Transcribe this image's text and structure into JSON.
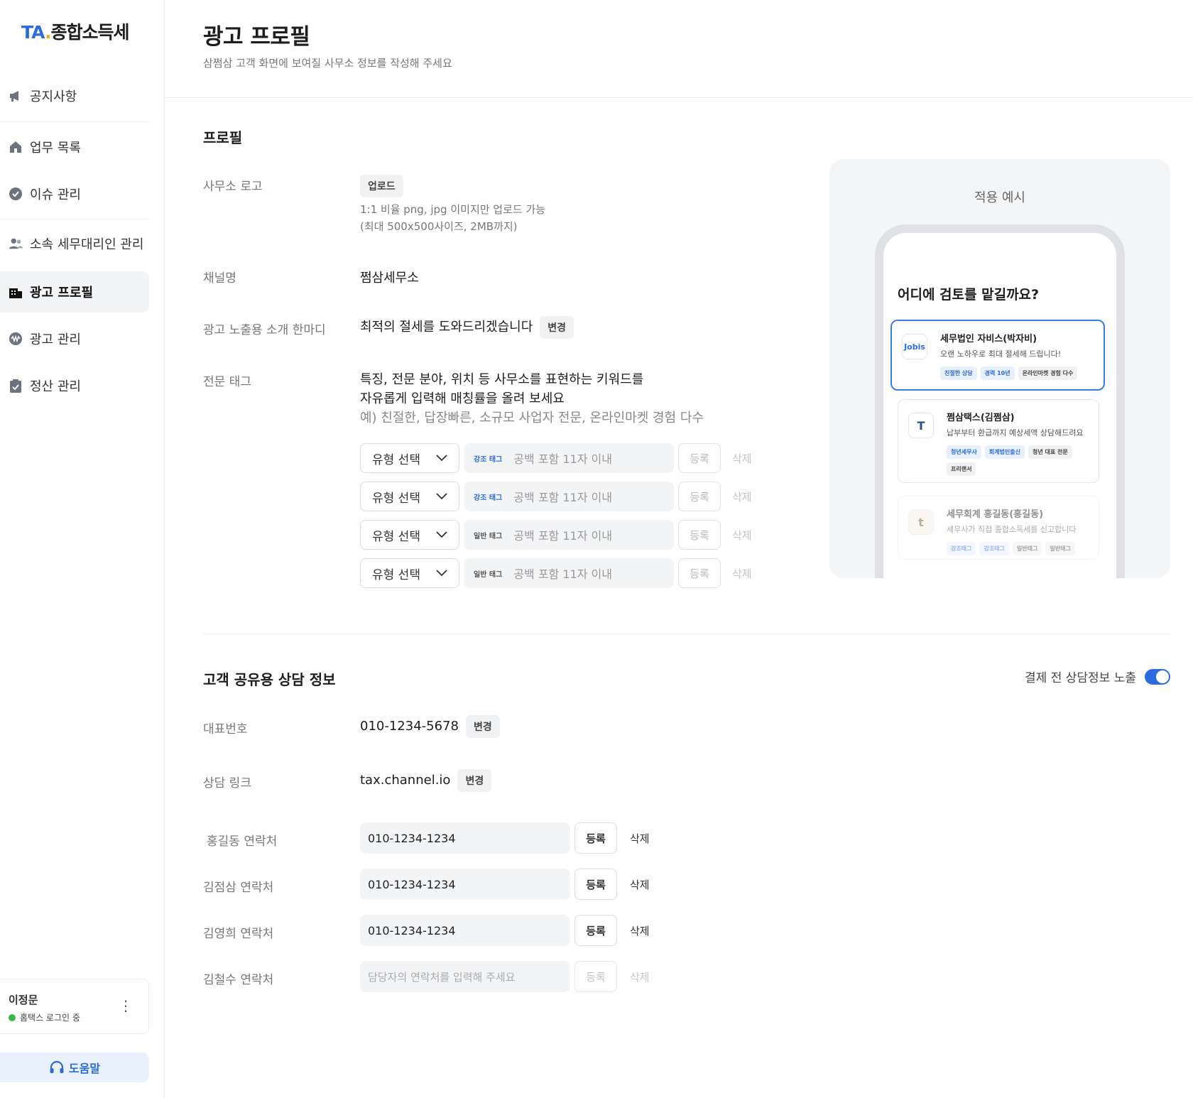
{
  "app": {
    "logo_ta": "TA",
    "logo_dot": ".",
    "logo_name": "종합소득세"
  },
  "sidebar": {
    "items": [
      {
        "label": "공지사항",
        "icon": "megaphone-icon"
      },
      {
        "label": "업무 목록",
        "icon": "home-icon"
      },
      {
        "label": "이슈 관리",
        "icon": "check-circle-icon"
      },
      {
        "label": "소속 세무대리인 관리",
        "icon": "users-icon"
      },
      {
        "label": "광고 프로필",
        "icon": "building-icon",
        "active": true
      },
      {
        "label": "광고 관리",
        "icon": "wave-icon"
      },
      {
        "label": "정산 관리",
        "icon": "clipboard-check-icon"
      }
    ],
    "user": {
      "name": "이정문",
      "status": "홈택스 로그인 중"
    },
    "help_label": "도움말"
  },
  "header": {
    "title": "광고 프로필",
    "subtitle": "삼쩜삼 고객 화면에 보여질 사무소 정보를 작성해 주세요"
  },
  "profile": {
    "section_title": "프로필",
    "logo_label": "사무소 로고",
    "upload_label": "업로드",
    "upload_hint_1": "1:1 비율 png, jpg 이미지만 업로드 가능",
    "upload_hint_2": "(최대 500x500사이즈, 2MB까지)",
    "channel_label": "채널명",
    "channel_value": "쩜삼세무소",
    "intro_label": "광고 노출용 소개 한마디",
    "intro_value": "최적의 절세를 도와드리겠습니다",
    "change_label": "변경",
    "tags_label": "전문 태그",
    "tags_desc_1": "특징, 전문 분야, 위치 등 사무소를 표현하는 키워드를",
    "tags_desc_2": "자유롭게 입력해 매칭률을 올려 보세요",
    "tags_desc_3": "예) 친절한, 답장빠른, 소규모 사업자 전문, 온라인마켓 경험 다수",
    "tag_rows": [
      {
        "select": "유형 선택",
        "kind": "강조 태그",
        "kind_style": "strong",
        "placeholder": "공백 포함 11자 이내",
        "register": "등록",
        "delete": "삭제"
      },
      {
        "select": "유형 선택",
        "kind": "강조 태그",
        "kind_style": "strong",
        "placeholder": "공백 포함 11자 이내",
        "register": "등록",
        "delete": "삭제"
      },
      {
        "select": "유형 선택",
        "kind": "일반 태그",
        "kind_style": "normal",
        "placeholder": "공백 포함 11자 이내",
        "register": "등록",
        "delete": "삭제"
      },
      {
        "select": "유형 선택",
        "kind": "일반 태그",
        "kind_style": "normal",
        "placeholder": "공백 포함 11자 이내",
        "register": "등록",
        "delete": "삭제"
      }
    ]
  },
  "preview": {
    "title": "적용 예시",
    "question": "어디에 검토를 맡길까요?",
    "cards": [
      {
        "logo": "Jobis",
        "name": "세무법인 자비스(박자비)",
        "desc": "오랜 노하우로 최대 절세해 드립니다!",
        "tags": [
          {
            "t": "친절한 상담",
            "blue": true
          },
          {
            "t": "경력 10년",
            "blue": true
          },
          {
            "t": "온라인마켓 경험 다수",
            "blue": false
          }
        ]
      },
      {
        "logo": "T",
        "name": "쩜삼택스(김쩜삼)",
        "desc": "납부부터 환급까지 예상세액 상담해드려요",
        "tags": [
          {
            "t": "청년세무사",
            "blue": true
          },
          {
            "t": "회계법인출신",
            "blue": true
          },
          {
            "t": "청년 대표 전문",
            "blue": false
          },
          {
            "t": "프리랜서",
            "blue": false
          }
        ]
      },
      {
        "logo": "t",
        "name": "세무회계 홍길동(홍길동)",
        "desc": "세무사가 직접 종합소득세를 신고합니다",
        "tags": [
          {
            "t": "강조태그",
            "blue": true
          },
          {
            "t": "강조태그",
            "blue": true
          },
          {
            "t": "일반태그",
            "blue": false
          },
          {
            "t": "일반태그",
            "blue": false
          }
        ]
      }
    ]
  },
  "consult": {
    "section_title": "고객 공유용 상담 정보",
    "toggle_label": "결제 전 상담정보 노출",
    "toggle_on": true,
    "phone_label": "대표번호",
    "phone_value": "010-1234-5678",
    "link_label": "상담 링크",
    "link_value": "tax.channel.io",
    "change_label": "변경",
    "contacts": [
      {
        "label": "홍길동 연락처",
        "value": "010-1234-1234",
        "placeholder": "",
        "register": "등록",
        "delete": "삭제",
        "enabled": true
      },
      {
        "label": "김점삼 연락처",
        "value": "010-1234-1234",
        "placeholder": "",
        "register": "등록",
        "delete": "삭제",
        "enabled": true
      },
      {
        "label": "김영희 연락처",
        "value": "010-1234-1234",
        "placeholder": "",
        "register": "등록",
        "delete": "삭제",
        "enabled": true
      },
      {
        "label": "김철수 연락처",
        "value": "",
        "placeholder": "담당자의 연락처를 입력해 주세요",
        "register": "등록",
        "delete": "삭제",
        "enabled": false
      }
    ]
  }
}
